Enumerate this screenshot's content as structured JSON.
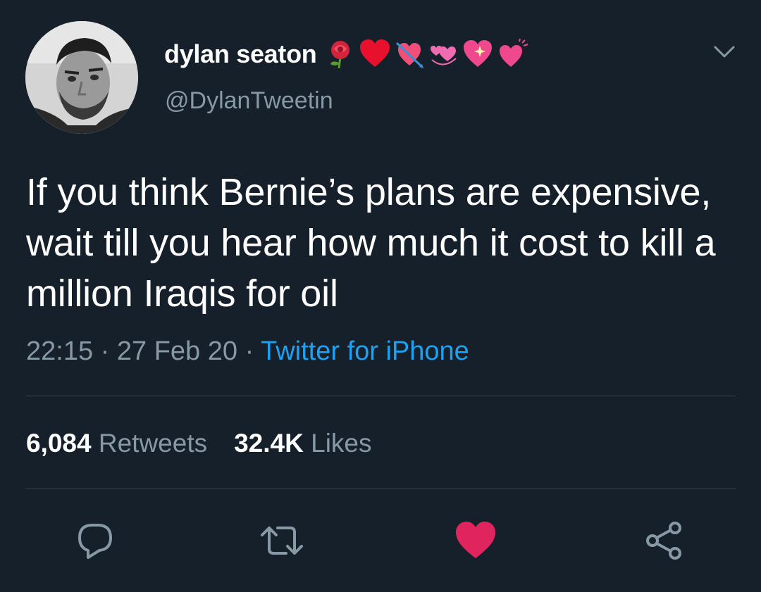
{
  "author": {
    "display_name": "dylan seaton",
    "handle": "@DylanTweetin",
    "name_emojis": [
      "rose-icon",
      "red-heart-icon",
      "heart-with-arrow-icon",
      "revolving-hearts-icon",
      "sparkling-heart-icon",
      "beating-heart-icon"
    ]
  },
  "tweet": {
    "text": "If you think Bernie’s plans are expensive, wait till you hear how much it cost to kill a million Iraqis for oil",
    "time": "22:15",
    "separator": "·",
    "date": "27 Feb 20",
    "source": "Twitter for iPhone"
  },
  "stats": {
    "retweets_count": "6,084",
    "retweets_label": "Retweets",
    "likes_count": "32.4K",
    "likes_label": "Likes"
  },
  "actions": [
    "reply-icon",
    "retweet-icon",
    "like-icon",
    "share-icon"
  ],
  "colors": {
    "background": "#15202b",
    "primary_text": "#ffffff",
    "secondary_text": "#8899a6",
    "link": "#1da1f2",
    "like_active": "#e0245e",
    "divider": "#38444d"
  }
}
